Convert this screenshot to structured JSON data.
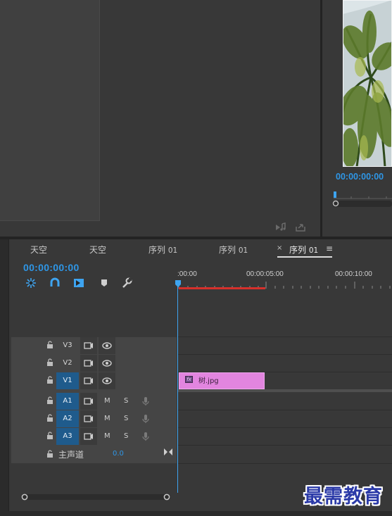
{
  "program_monitor": {
    "timecode": "00:00:00:00"
  },
  "timeline": {
    "tabs": [
      {
        "label": "天空",
        "num": ""
      },
      {
        "label": "天空",
        "num": ""
      },
      {
        "label": "序列",
        "num": "01"
      },
      {
        "label": "序列",
        "num": "01"
      },
      {
        "label": "序列",
        "num": "01"
      }
    ],
    "close_glyph": "×",
    "menu_glyph": "≡",
    "timecode": "00:00:00:00",
    "ruler_labels": [
      ":00:00",
      "00:00:05:00",
      "00:00:10:00"
    ],
    "tools": [
      "snap-icon",
      "magnet-icon",
      "linked-selection-icon",
      "marker-icon",
      "wrench-icon"
    ],
    "video_tracks": [
      {
        "name": "V3",
        "target": false
      },
      {
        "name": "V2",
        "target": false
      },
      {
        "name": "V1",
        "target": true
      }
    ],
    "audio_tracks": [
      {
        "name": "A1",
        "m": "M",
        "s": "S"
      },
      {
        "name": "A2",
        "m": "M",
        "s": "S"
      },
      {
        "name": "A3",
        "m": "M",
        "s": "S"
      }
    ],
    "master": {
      "label": "主声道",
      "value": "0.0"
    },
    "clip": {
      "label": "树.jpg",
      "fx": "fx",
      "color": "#e285df"
    },
    "accent_color": "#2e96e6",
    "playhead_color": "#3ea4f0",
    "work_area_color": "#d6302b"
  },
  "watermark": "最需教育"
}
